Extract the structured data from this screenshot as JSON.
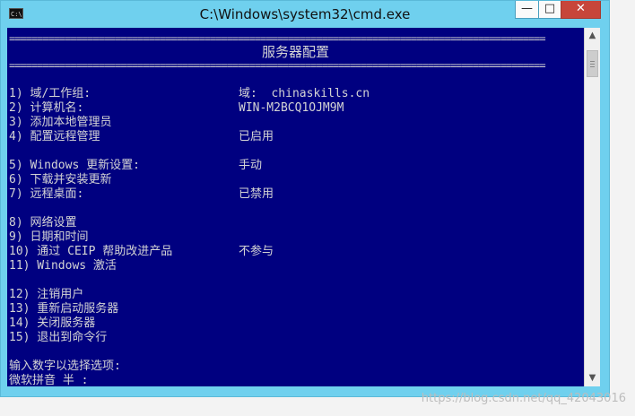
{
  "window": {
    "title": "C:\\Windows\\system32\\cmd.exe",
    "app_icon_text": "C:\\",
    "controls": {
      "minimize": "—",
      "maximize": "□",
      "close": "✕"
    }
  },
  "console": {
    "rule": "================================================================================================",
    "heading": "服务器配置",
    "items": [
      {
        "label": "1) 域/工作组:",
        "value": "域:  chinaskills.cn"
      },
      {
        "label": "2) 计算机名:",
        "value": "WIN-M2BCQ1OJM9M"
      },
      {
        "label": "3) 添加本地管理员",
        "value": ""
      },
      {
        "label": "4) 配置远程管理",
        "value": "已启用"
      },
      {
        "label": "5) Windows 更新设置:",
        "value": "手动"
      },
      {
        "label": "6) 下载并安装更新",
        "value": ""
      },
      {
        "label": "7) 远程桌面:",
        "value": "已禁用"
      },
      {
        "label": "8) 网络设置",
        "value": ""
      },
      {
        "label": "9) 日期和时间",
        "value": ""
      },
      {
        "label": "10) 通过 CEIP 帮助改进产品",
        "value": "不参与"
      },
      {
        "label": "11) Windows 激活",
        "value": ""
      },
      {
        "label": "12) 注销用户",
        "value": ""
      },
      {
        "label": "13) 重新启动服务器",
        "value": ""
      },
      {
        "label": "14) 关闭服务器",
        "value": ""
      },
      {
        "label": "15) 退出到命令行",
        "value": ""
      }
    ],
    "prompt": "输入数字以选择选项:",
    "ime_status": "微软拼音 半 :"
  },
  "scrollbar": {
    "up_arrow": "▲",
    "down_arrow": "▼"
  },
  "watermark": "https://blog.csdn.net/qq_42043016",
  "colors": {
    "console_bg": "#000080",
    "console_fg": "#d4d4d4",
    "titlebar": "#6fd0ee",
    "close_button": "#c7463a"
  }
}
